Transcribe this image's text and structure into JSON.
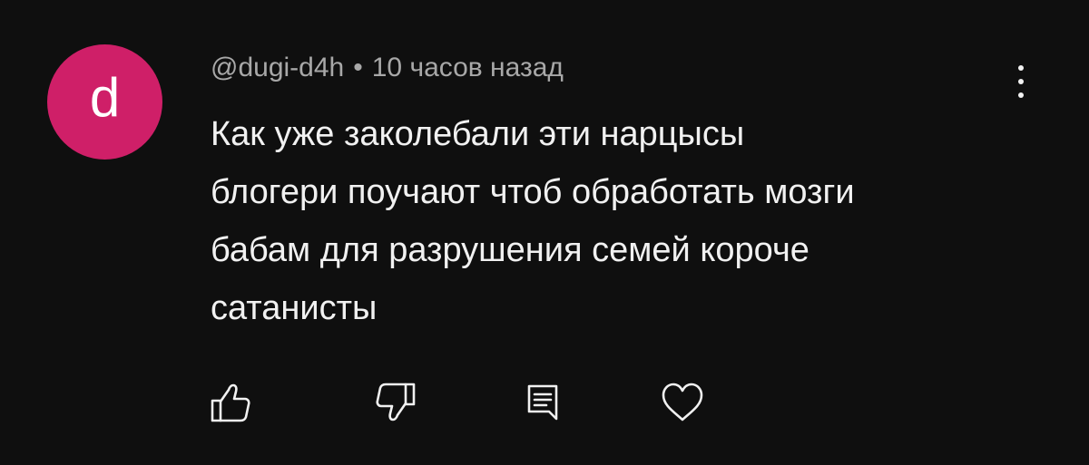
{
  "comment": {
    "avatar_letter": "d",
    "avatar_color": "#cf1f68",
    "author": "@dugi-d4h",
    "separator": "•",
    "time": "10 часов назад",
    "text_lines": [
      "Как уже заколебали эти нарцысы",
      "блогери поучают чтоб обработать мозги",
      "бабам для разрушения семей короче",
      "сатанисты"
    ],
    "actions": [
      {
        "icon": "thumbs-up-icon"
      },
      {
        "icon": "thumbs-down-icon"
      },
      {
        "icon": "reply-icon"
      },
      {
        "icon": "heart-icon"
      }
    ],
    "menu_icon": "more-vertical-icon"
  }
}
